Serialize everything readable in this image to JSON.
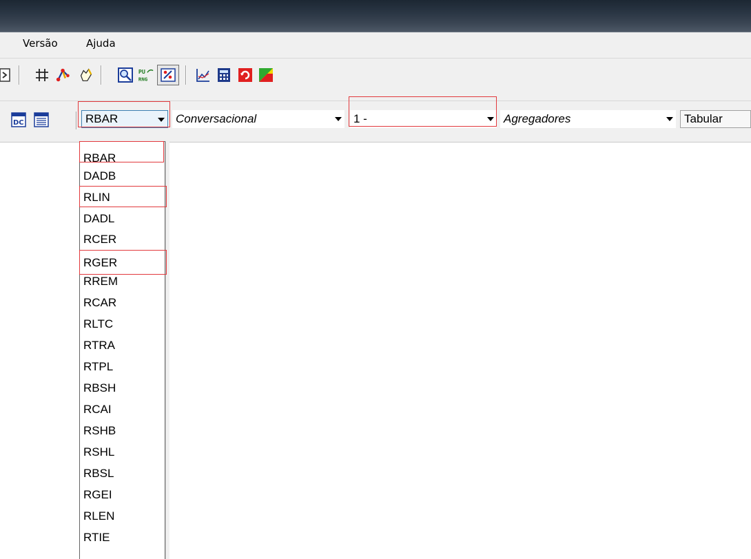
{
  "menubar": {
    "items": [
      "Versão",
      "Ajuda"
    ]
  },
  "toolbar_icons": [
    "navigate-arrow-icon",
    "grid-hash-icon",
    "node-link-icon",
    "pointer-hand-icon",
    "zoom-search-icon",
    "pu-rng-icon",
    "percent-tool-icon",
    "line-chart-icon",
    "calculator-icon",
    "cycle-refresh-icon",
    "color-map-icon"
  ],
  "comboToolbar": {
    "dc_icon": "dc-icon",
    "list_icon": "list-view-icon",
    "report_combo": "RBAR",
    "mode_combo": "Conversacional",
    "number_combo": "1 -",
    "group_combo": "Agregadores",
    "tabular_button": "Tabular"
  },
  "dropdown": {
    "items": [
      "RBAR",
      "DADB",
      "RLIN",
      "DADL",
      "RCER",
      "RGER",
      "RREM",
      "RCAR",
      "RLTC",
      "RTRA",
      "RTPL",
      "RBSH",
      "RCAI",
      "RSHB",
      "RSHL",
      "RBSL",
      "RGEI",
      "RLEN",
      "RTIE"
    ],
    "highlighted": [
      "RBAR",
      "RLIN",
      "RGER"
    ]
  },
  "colors": {
    "highlight": "#e2383c",
    "selection": "#3399ff"
  }
}
